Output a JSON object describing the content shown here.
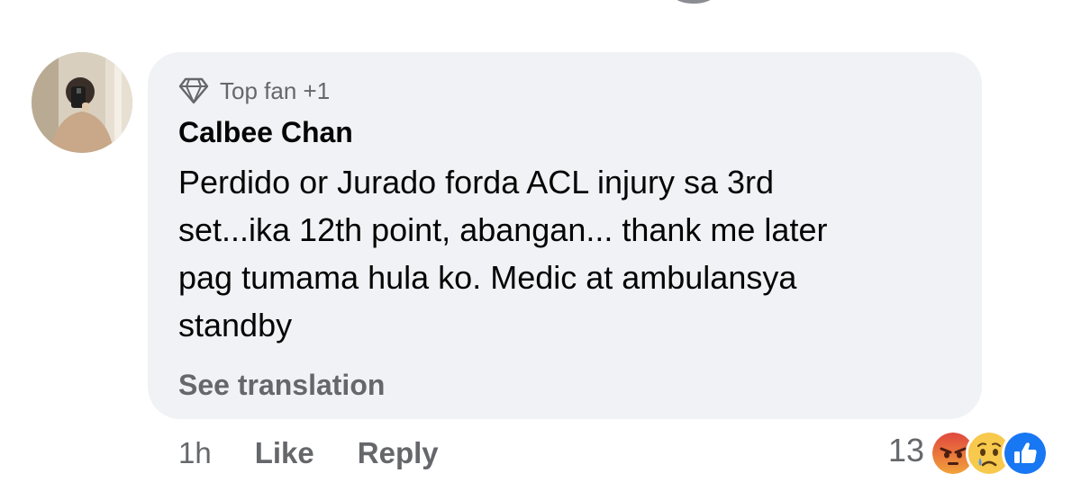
{
  "comment": {
    "badge": "Top fan +1",
    "author": "Calbee Chan",
    "text": "Perdido or Jurado forda ACL injury sa 3rd\nset...ika 12th point, abangan... thank me later\npag tumama hula ko. Medic at ambulansya\nstandby",
    "see_translation": "See translation"
  },
  "actions": {
    "time": "1h",
    "like": "Like",
    "reply": "Reply"
  },
  "reactions": {
    "count": "13",
    "icons": [
      "angry-icon",
      "sad-icon",
      "like-icon"
    ]
  },
  "colors": {
    "bubble": "#f0f2f5",
    "secondary_text": "#65676b",
    "like_blue": "#1877f2",
    "angry": "#e9710f"
  }
}
